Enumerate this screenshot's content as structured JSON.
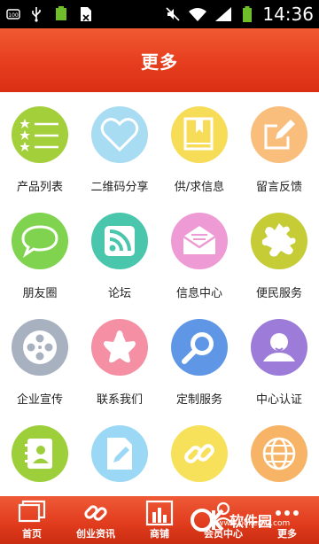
{
  "status_bar": {
    "time": "14:36",
    "battery_percent_label": "100%",
    "icons": [
      "sd-card-icon",
      "usb-icon",
      "battery-icon",
      "document-icon",
      "mute-icon",
      "wifi-icon",
      "signal-icon",
      "battery-icon"
    ]
  },
  "header": {
    "title": "更多"
  },
  "grid": {
    "items": [
      {
        "label": "产品列表",
        "icon": "star-list-icon",
        "color": "#a3cf3b"
      },
      {
        "label": "二维码分享",
        "icon": "heart-icon",
        "color": "#a8dcf2"
      },
      {
        "label": "供/求信息",
        "icon": "book-icon",
        "color": "#f7dc58"
      },
      {
        "label": "留言反馈",
        "icon": "edit-note-icon",
        "color": "#f9bd7c"
      },
      {
        "label": "朋友圈",
        "icon": "chat-bubble-icon",
        "color": "#7fd34e"
      },
      {
        "label": "论坛",
        "icon": "rss-icon",
        "color": "#49c6ac"
      },
      {
        "label": "信息中心",
        "icon": "mail-icon",
        "color": "#ee9ad4"
      },
      {
        "label": "便民服务",
        "icon": "puzzle-icon",
        "color": "#c5cc35"
      },
      {
        "label": "企业宣传",
        "icon": "film-reel-icon",
        "color": "#a8b1c0"
      },
      {
        "label": "联系我们",
        "icon": "star-badge-icon",
        "color": "#f58fa3"
      },
      {
        "label": "定制服务",
        "icon": "magnifier-icon",
        "color": "#5f97e6"
      },
      {
        "label": "中心认证",
        "icon": "user-icon",
        "color": "#9c7bd9"
      },
      {
        "label": "",
        "icon": "contact-book-icon",
        "color": "#9ccf3a"
      },
      {
        "label": "",
        "icon": "doc-edit-icon",
        "color": "#9ad8f5"
      },
      {
        "label": "",
        "icon": "link-icon",
        "color": "#f7e05a"
      },
      {
        "label": "",
        "icon": "globe-icon",
        "color": "#f7b466"
      }
    ]
  },
  "tabbar": {
    "tabs": [
      {
        "label": "首页",
        "icon": "home-icon"
      },
      {
        "label": "创业资讯",
        "icon": "link-icon"
      },
      {
        "label": "商铺",
        "icon": "chart-icon"
      },
      {
        "label": "会员中心",
        "icon": "member-icon"
      },
      {
        "label": "更多",
        "icon": "more-icon"
      }
    ]
  },
  "watermark": {
    "brand": "软件园",
    "url": "www.pokemu.com"
  }
}
